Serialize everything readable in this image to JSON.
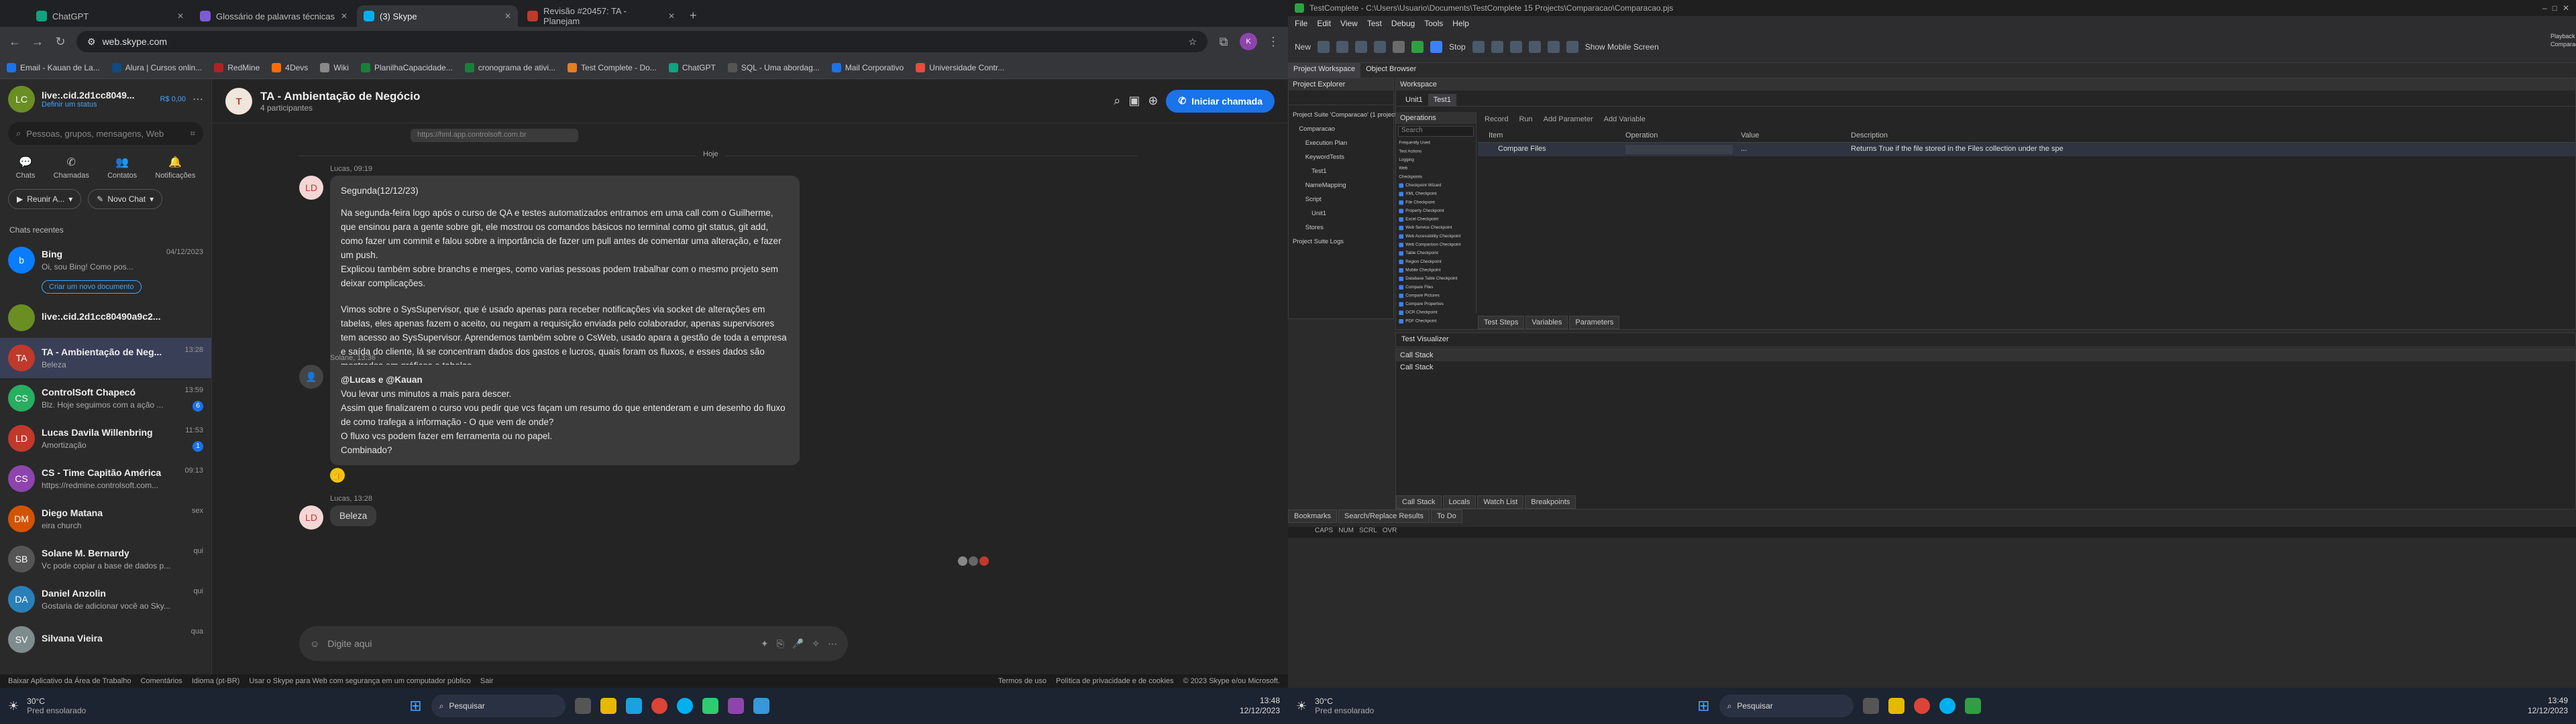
{
  "chrome": {
    "tabs": [
      {
        "label": "ChatGPT",
        "color": "#10a37f"
      },
      {
        "label": "Glossário de palavras técnicas",
        "color": "#7b5bd6"
      },
      {
        "label": "(3) Skype",
        "color": "#00aff0"
      },
      {
        "label": "Revisão #20457: TA - Planejam",
        "color": "#c0392b"
      }
    ],
    "url": "web.skype.com",
    "bookmarks": [
      {
        "label": "Email - Kauan de La...",
        "color": "#1a73e8"
      },
      {
        "label": "Alura | Cursos onlin...",
        "color": "#0f4c81"
      },
      {
        "label": "RedMine",
        "color": "#b32024"
      },
      {
        "label": "4Devs",
        "color": "#ff6b00"
      },
      {
        "label": "Wiki",
        "color": "#888"
      },
      {
        "label": "PlanilhaCapacidade...",
        "color": "#188038"
      },
      {
        "label": "cronograma de ativi...",
        "color": "#188038"
      },
      {
        "label": "Test Complete - Do...",
        "color": "#e67e22"
      },
      {
        "label": "ChatGPT",
        "color": "#10a37f"
      },
      {
        "label": "SQL - Uma abordag...",
        "color": "#555"
      },
      {
        "label": "Mail Corporativo",
        "color": "#1a73e8"
      },
      {
        "label": "Universidade Contr...",
        "color": "#e74c3c"
      }
    ]
  },
  "skype": {
    "profile": {
      "name": "live:.cid.2d1cc8049...",
      "status": "Definir um status",
      "credit": "R$ 0,00",
      "initials": "LC"
    },
    "search_placeholder": "Pessoas, grupos, mensagens, Web",
    "nav": [
      {
        "label": "Chats",
        "badge": "3"
      },
      {
        "label": "Chamadas",
        "badge": ""
      },
      {
        "label": "Contatos",
        "badge": ""
      },
      {
        "label": "Notificações",
        "badge": "1"
      }
    ],
    "meet_label": "Reunir A...",
    "newchat_label": "Novo Chat",
    "recent_label": "Chats recentes",
    "bing": {
      "name": "Bing",
      "time": "04/12/2023",
      "preview": "Oi, sou Bing! Como pos...",
      "new_conv": "Criar um novo documento"
    },
    "chats": [
      {
        "name": "live:.cid.2d1cc80490a9c2...",
        "preview": "",
        "time": "",
        "badge": "",
        "initials": "",
        "color": "#6b8e23",
        "selected": false
      },
      {
        "name": "TA - Ambientação de Neg...",
        "preview": "Beleza",
        "time": "13:28",
        "badge": "",
        "initials": "TA",
        "color": "#c0392b",
        "selected": true
      },
      {
        "name": "ControlSoft Chapecó",
        "preview": "Blz. Hoje seguimos com a ação ...",
        "time": "13:59",
        "badge": "6",
        "initials": "CS",
        "color": "#27ae60",
        "selected": false
      },
      {
        "name": "Lucas Davila Willenbring",
        "preview": "Amortização",
        "time": "11:53",
        "badge": "1",
        "initials": "LD",
        "color": "#c0392b",
        "selected": false
      },
      {
        "name": "CS - Time Capitão América",
        "preview": "https://redmine.controlsoft.com...",
        "time": "09:13",
        "badge": "",
        "initials": "CS",
        "color": "#8e44ad",
        "selected": false
      },
      {
        "name": "Diego Matana",
        "preview": "eira church",
        "time": "sex",
        "badge": "",
        "initials": "DM",
        "color": "#d35400",
        "selected": false
      },
      {
        "name": "Solane M. Bernardy",
        "preview": "Vc pode copiar a base de dados p...",
        "time": "qui",
        "badge": "",
        "initials": "SB",
        "color": "#555",
        "selected": false
      },
      {
        "name": "Daniel Anzolin",
        "preview": "Gostaria de adicionar você ao Sky...",
        "time": "qui",
        "badge": "",
        "initials": "DA",
        "color": "#2980b9",
        "selected": false
      },
      {
        "name": "Silvana Vieira",
        "preview": "",
        "time": "qua",
        "badge": "",
        "initials": "SV",
        "color": "#7f8c8d",
        "selected": false
      }
    ],
    "conv": {
      "title": "TA - Ambientação de Negócio",
      "participants": "4 participantes",
      "call_label": "Iniciar chamada",
      "link_preview": "https://hml.app.controlsoft.com.br",
      "today": "Hoje",
      "m1": {
        "meta": "Lucas, 09:19",
        "initials": "LD",
        "lines": [
          "Segunda(12/12/23)",
          "Na segunda-feira logo após o curso de QA e testes automatizados entramos em uma call com o Guilherme,  que ensinou para a gente sobre git, ele mostrou os comandos básicos no terminal como git status, git add, como fazer um commit e falou sobre a importância de fazer um pull antes de comentar uma alteração, e fazer um push.",
          "Explicou também sobre branchs e merges, como varias pessoas podem trabalhar com o mesmo projeto sem deixar complicações.",
          "Vimos sobre o SysSupervisor, que é usado apenas para receber notificações via socket de alterações em tabelas,  eles apenas fazem o aceito, ou negam a requisição enviada pelo colaborador, apenas supervisores tem acesso ao SysSupervisor. Aprendemos também sobre o CsWeb, usado apara a gestão de toda a empresa e saída do cliente, lá se concentram dados dos gastos e lucros, quais foram os fluxos, e esses dados são mostrados em gráficos e tabelas."
        ]
      },
      "m2": {
        "meta": "Solane, 13:36",
        "lines": [
          "@Lucas e @Kauan",
          "Vou levar uns minutos a mais para descer.",
          "Assim que finalizarem o curso vou pedir que vcs façam um resumo do que entenderam e um desenho do fluxo de como trafega a informação -   O que vem de onde?",
          "O fluxo vcs podem fazer em ferramenta ou no papel.",
          "Combinado?"
        ]
      },
      "m3": {
        "meta": "Lucas, 13:28",
        "initials": "LD",
        "text": "Beleza"
      },
      "composer_placeholder": "Digite aqui"
    },
    "footer": [
      "Baixar Aplicativo da Área de Trabalho",
      "Comentários",
      "Idioma (pt-BR)",
      "Usar o Skype para Web com segurança em um computador público",
      "Sair",
      "Termos de uso",
      "Política de privacidade e de cookies",
      "© 2023 Skype e/ou Microsoft."
    ]
  },
  "taskbar": {
    "weather": "30°C",
    "weather_desc": "Pred ensolarado",
    "search": "Pesquisar",
    "time": "13:48",
    "date": "12/12/2023",
    "time2": "13:49",
    "date2": "12/12/2023"
  },
  "tc": {
    "title": "TestComplete - C:\\Users\\Usuario\\Documents\\TestComplete 15 Projects\\Comparacao\\Comparacao.pjs",
    "menu": [
      "File",
      "Edit",
      "View",
      "Test",
      "Debug",
      "Tools",
      "Help"
    ],
    "toolbar": {
      "new": "New",
      "stop": "Stop",
      "mobile": "Show Mobile Screen"
    },
    "tabs": [
      "Project Workspace",
      "Object Browser"
    ],
    "explorer_title": "Project Explorer",
    "workspace_title": "Workspace",
    "tree": [
      {
        "t": "Project Suite 'Comparacao' (1 project)",
        "d": 0
      },
      {
        "t": "Comparacao",
        "d": 1
      },
      {
        "t": "Execution Plan",
        "d": 2
      },
      {
        "t": "KeywordTests",
        "d": 2
      },
      {
        "t": "Test1",
        "d": 3
      },
      {
        "t": "NameMapping",
        "d": 2
      },
      {
        "t": "Script",
        "d": 2
      },
      {
        "t": "Unit1",
        "d": 3
      },
      {
        "t": "Stores",
        "d": 2
      },
      {
        "t": "Project Suite Logs",
        "d": 0
      }
    ],
    "doc_tabs": [
      "Unit1",
      "Test1"
    ],
    "kw_toolbar": [
      "Record",
      "Run",
      "Add Parameter",
      "Add Variable"
    ],
    "ops_title": "Operations",
    "ops_search": "Search",
    "ops": [
      "Frequently Used",
      "Test Actions",
      "Logging",
      "Web",
      "Checkpoints",
      "Checkpoint Wizard",
      "XML Checkpoint",
      "File Checkpoint",
      "Property Checkpoint",
      "Excel Checkpoint",
      "Web Service Checkpoint",
      "Web Accessibility Checkpoint",
      "Web Comparison Checkpoint",
      "Table Checkpoint",
      "Region Checkpoint",
      "Mobile Checkpoint",
      "Database Table Checkpoint",
      "Compare Files",
      "Compare Pictures",
      "Compare Properties",
      "OCR Checkpoint",
      "PDF Checkpoint"
    ],
    "cols": [
      "Item",
      "Operation",
      "Value",
      "Description"
    ],
    "row": {
      "item": "Compare Files",
      "value": "...",
      "desc": "Returns True if the file stored in the Files collection under the spe"
    },
    "bottom_tabs": [
      "Test Steps",
      "Variables",
      "Parameters"
    ],
    "visualizer": "Test Visualizer",
    "callstack": "Call Stack",
    "callstack2": "Call Stack",
    "debug_tabs": [
      "Call Stack",
      "Locals",
      "Watch List",
      "Breakpoints"
    ],
    "left_bottom_tabs": [
      "Bookmarks",
      "Search/Replace Results",
      "To Do"
    ],
    "status": [
      "CAPS",
      "NUM",
      "SCRL",
      "OVR"
    ],
    "right_panel": [
      "Playback",
      "Comparacao"
    ]
  }
}
